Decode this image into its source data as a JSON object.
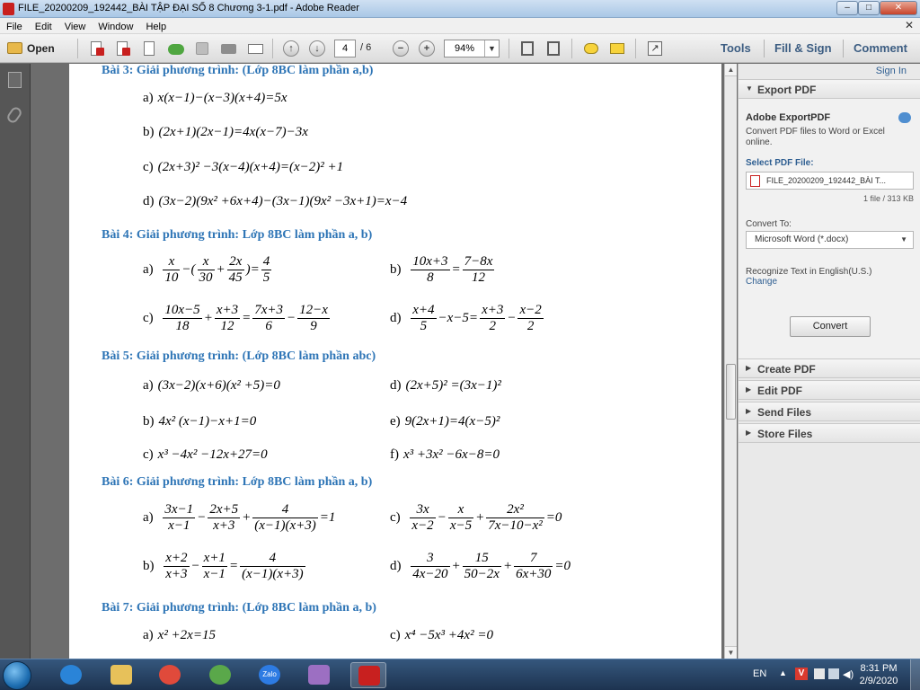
{
  "window": {
    "title": "FILE_20200209_192442_BÀI TẬP ĐẠI SỐ 8 Chương 3-1.pdf - Adobe Reader",
    "minimize_glyph": "–",
    "maximize_glyph": "□",
    "close_glyph": "✕"
  },
  "menu": {
    "items": [
      "File",
      "Edit",
      "View",
      "Window",
      "Help"
    ],
    "close_glyph": "✕"
  },
  "toolbar": {
    "open_label": "Open",
    "page_current": "4",
    "page_total": "/ 6",
    "zoom": "94%",
    "zoom_arrow": "▼",
    "prev_glyph": "↑",
    "next_glyph": "↓",
    "zoom_out_glyph": "−",
    "zoom_in_glyph": "+",
    "expand_glyph": "↗",
    "tools_label": "Tools",
    "fill_sign_label": "Fill & Sign",
    "comment_label": "Comment",
    "icons": [
      "folder-icon",
      "create-pdf-icon",
      "export-pdf-icon",
      "edit-icon",
      "cloud-upload-icon",
      "save-icon",
      "print-icon",
      "email-icon",
      "page-up-icon",
      "page-down-icon",
      "zoom-out-icon",
      "zoom-in-icon",
      "fit-page-icon",
      "fit-width-icon",
      "sticky-note-icon",
      "highlight-icon",
      "read-mode-icon"
    ]
  },
  "document": {
    "bai3": {
      "title": "Bài 3: Giải phương trình: (Lớp 8BC làm phần a,b)",
      "a": "x(x−1)−(x−3)(x+4)=5x",
      "b": "(2x+1)(2x−1)=4x(x−7)−3x",
      "c": "(2x+3)² −3(x−4)(x+4)=(x−2)² +1",
      "d": "(3x−2)(9x² +6x+4)−(3x−1)(9x² −3x+1)=x−4"
    },
    "bai4": {
      "title": "Bài 4: Giải phương trình: Lớp 8BC làm phần a, b)",
      "a": {
        "f1n": "x",
        "f1d": "10",
        "f2n": "x",
        "f2d": "30",
        "f3n": "2x",
        "f3d": "45",
        "f4n": "4",
        "f4d": "5"
      },
      "b": {
        "f1n": "10x+3",
        "f1d": "8",
        "f2n": "7−8x",
        "f2d": "12"
      },
      "c": {
        "f1n": "10x−5",
        "f1d": "18",
        "f2n": "x+3",
        "f2d": "12",
        "f3n": "7x+3",
        "f3d": "6",
        "f4n": "12−x",
        "f4d": "9"
      },
      "d": {
        "f1n": "x+4",
        "f1d": "5",
        "mid": "−x−5=",
        "f2n": "x+3",
        "f2d": "2",
        "f3n": "x−2",
        "f3d": "2"
      }
    },
    "bai5": {
      "title": "Bài 5: Giải phương trình: (Lớp 8BC làm phần abc)",
      "a": "(3x−2)(x+6)(x² +5)=0",
      "b": "4x² (x−1)−x+1=0",
      "c": "x³ −4x² −12x+27=0",
      "d": "(2x+5)² =(3x−1)²",
      "e": "9(2x+1)=4(x−5)²",
      "f": "x³ +3x² −6x−8=0"
    },
    "bai6": {
      "title": "Bài 6: Giải phương trình: Lớp 8BC làm phần a, b)",
      "a": {
        "f1n": "3x−1",
        "f1d": "x−1",
        "f2n": "2x+5",
        "f2d": "x+3",
        "f3n": "4",
        "f3d": "(x−1)(x+3)",
        "rhs": "=1"
      },
      "b": {
        "f1n": "x+2",
        "f1d": "x+3",
        "f2n": "x+1",
        "f2d": "x−1",
        "f3n": "4",
        "f3d": "(x−1)(x+3)"
      },
      "c": {
        "f1n": "3x",
        "f1d": "x−2",
        "f2n": "x",
        "f2d": "x−5",
        "f3n": "2x²",
        "f3d": "7x−10−x²",
        "rhs": "=0"
      },
      "d": {
        "f1n": "3",
        "f1d": "4x−20",
        "f2n": "15",
        "f2d": "50−2x",
        "f3n": "7",
        "f3d": "6x+30",
        "rhs": "=0"
      }
    },
    "bai7": {
      "title": "Bài 7: Giải phương trình: (Lớp 8BC làm phần a, b)",
      "a": "x² +2x=15",
      "c": "x⁴ −5x³ +4x² =0"
    },
    "labels": {
      "a": "a)",
      "b": "b)",
      "c": "c)",
      "d": "d)",
      "e": "e)",
      "f": "f)"
    }
  },
  "scrollbar": {
    "position": 0.56,
    "up_glyph": "▲",
    "down_glyph": "▼"
  },
  "rightpane": {
    "sign_in": "Sign In",
    "export_pdf": "Export PDF",
    "export_heading": "Adobe ExportPDF",
    "export_desc": "Convert PDF files to Word or Excel online.",
    "select_label": "Select PDF File:",
    "file_name": "FILE_20200209_192442_BÀI T...",
    "file_info": "1 file / 313 KB",
    "convert_to_label": "Convert To:",
    "convert_to_value": "Microsoft Word (*.docx)",
    "recognize": "Recognize Text in English(U.S.)",
    "change": "Change",
    "convert_button": "Convert",
    "sections": [
      "Create PDF",
      "Edit PDF",
      "Send Files",
      "Store Files"
    ],
    "expanded_glyph": "▼",
    "collapsed_glyph": "▶"
  },
  "taskbar": {
    "language": "EN",
    "tray_up_glyph": "▲",
    "v_glyph": "V",
    "volume_glyph": "◀)",
    "time": "8:31 PM",
    "date": "2/9/2020",
    "apps": [
      "internet-explorer-icon",
      "file-explorer-icon",
      "chrome-icon",
      "coccoc-icon",
      "zalo-icon",
      "paint-icon",
      "adobe-reader-icon"
    ],
    "zalo_label": "Zalo",
    "colors": {
      "ie": "#2a84d8",
      "explorer": "#e7c15a",
      "chrome": "#e04a3b",
      "coccoc": "#5aa84a",
      "zalo": "#2d7be3",
      "paint": "#9c6fc2",
      "reader": "#c8201f"
    }
  },
  "colors": {
    "heading": "#2e75b6",
    "link": "#2e5e91",
    "brand": "#c8201f"
  }
}
